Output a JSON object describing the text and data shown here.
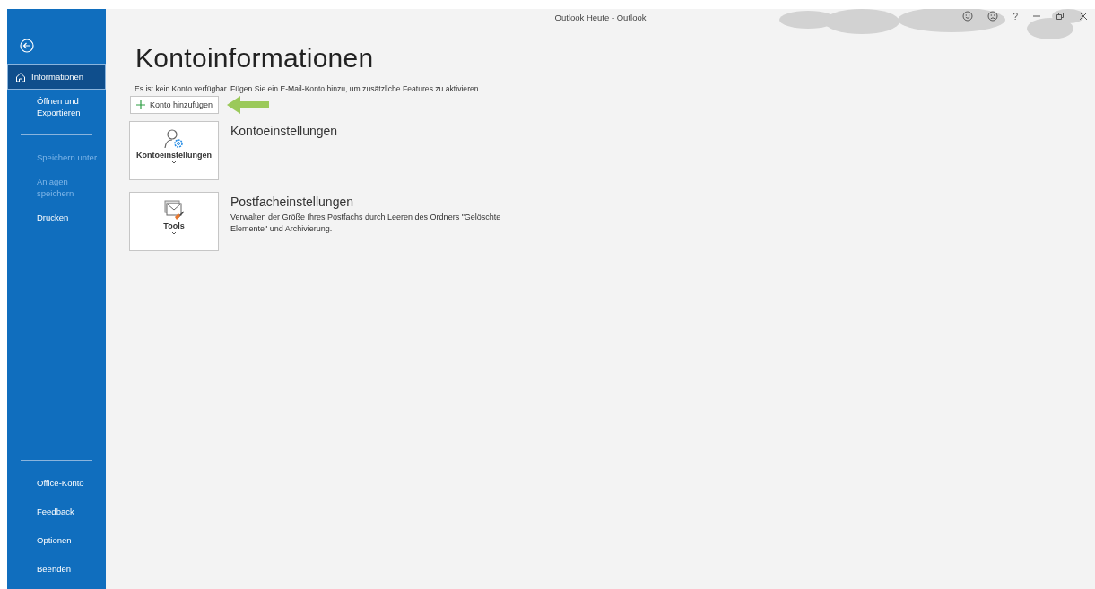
{
  "window": {
    "title": "Outlook Heute - Outlook",
    "help": "?"
  },
  "sidebar": {
    "groups": [
      [
        {
          "label": "Informationen",
          "selected": true,
          "disabled": false
        },
        {
          "label": "Öffnen und Exportieren",
          "selected": false,
          "disabled": false
        }
      ],
      [
        {
          "label": "Speichern unter",
          "selected": false,
          "disabled": true
        },
        {
          "label": "Anlagen speichern",
          "selected": false,
          "disabled": true
        },
        {
          "label": "Drucken",
          "selected": false,
          "disabled": false
        }
      ],
      [
        {
          "label": "Office-Konto",
          "selected": false,
          "disabled": false
        },
        {
          "label": "Feedback",
          "selected": false,
          "disabled": false
        },
        {
          "label": "Optionen",
          "selected": false,
          "disabled": false
        },
        {
          "label": "Beenden",
          "selected": false,
          "disabled": false
        }
      ]
    ]
  },
  "page": {
    "title": "Kontoinformationen",
    "message": "Es ist kein Konto verfügbar. Fügen Sie ein E-Mail-Konto hinzu, um zusätzliche Features zu aktivieren.",
    "add_button": "Konto hinzufügen",
    "sections": [
      {
        "kind": "account",
        "button": "Kontoeinstellungen",
        "heading": "Kontoeinstellungen"
      },
      {
        "kind": "tools",
        "button": "Tools",
        "heading": "Postfacheinstellungen",
        "description": "Verwalten der Größe Ihres Postfachs durch Leeren des Ordners \"Gelöschte Elemente\" und Archivierung."
      }
    ]
  }
}
